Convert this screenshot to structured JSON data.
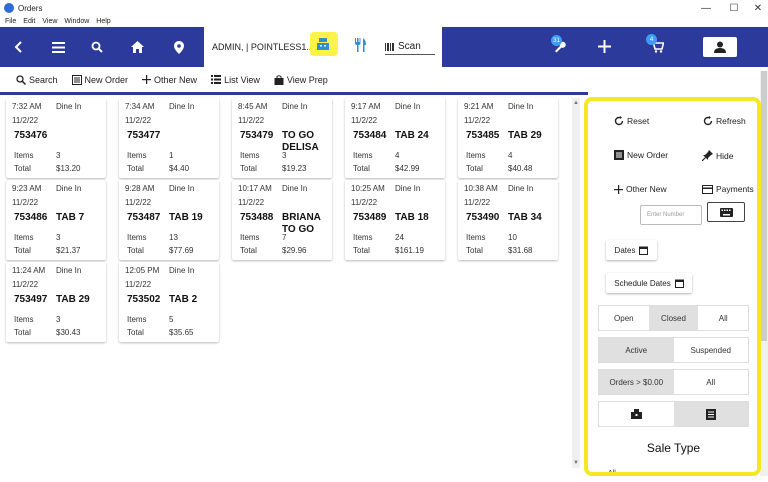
{
  "window": {
    "title": "Orders",
    "menu": [
      "File",
      "Edit",
      "View",
      "Window",
      "Help"
    ],
    "controls": [
      "—",
      "☐",
      "✕"
    ]
  },
  "header": {
    "user_label": "ADMIN, | POINTLESS1... |",
    "scan_label": "Scan",
    "badge_tools": "31",
    "badge_cart": "4",
    "accent": "#2b3a9b",
    "highlight": "#f5e721"
  },
  "toolbar": {
    "search": "Search",
    "new_order": "New Order",
    "other_new": "Other New",
    "list_view": "List View",
    "view_prep": "View Prep"
  },
  "orders": [
    {
      "time": "7:32 AM",
      "type": "Dine In",
      "date": "11/2/22",
      "number": "753476",
      "tab": "",
      "items_label": "Items",
      "items": "3",
      "total_label": "Total",
      "total": "$13.20"
    },
    {
      "time": "7:34 AM",
      "type": "Dine In",
      "date": "11/2/22",
      "number": "753477",
      "tab": "",
      "items_label": "Items",
      "items": "1",
      "total_label": "Total",
      "total": "$4.40"
    },
    {
      "time": "8:45 AM",
      "type": "Dine In",
      "date": "11/2/22",
      "number": "753479",
      "tab": "TO GO DELISA",
      "items_label": "Items",
      "items": "3",
      "total_label": "Total",
      "total": "$19.23"
    },
    {
      "time": "9:17 AM",
      "type": "Dine In",
      "date": "11/2/22",
      "number": "753484",
      "tab": "TAB 24",
      "items_label": "Items",
      "items": "4",
      "total_label": "Total",
      "total": "$42.99"
    },
    {
      "time": "9:21 AM",
      "type": "Dine In",
      "date": "11/2/22",
      "number": "753485",
      "tab": "TAB 29",
      "items_label": "Items",
      "items": "4",
      "total_label": "Total",
      "total": "$40.48"
    },
    {
      "time": "9:23 AM",
      "type": "Dine In",
      "date": "11/2/22",
      "number": "753486",
      "tab": "TAB 7",
      "items_label": "Items",
      "items": "3",
      "total_label": "Total",
      "total": "$21.37"
    },
    {
      "time": "9:28 AM",
      "type": "Dine In",
      "date": "11/2/22",
      "number": "753487",
      "tab": "TAB 19",
      "items_label": "Items",
      "items": "13",
      "total_label": "Total",
      "total": "$77.69"
    },
    {
      "time": "10:17 AM",
      "type": "Dine In",
      "date": "11/2/22",
      "number": "753488",
      "tab": "BRIANA TO GO",
      "items_label": "Items",
      "items": "7",
      "total_label": "Total",
      "total": "$29.96"
    },
    {
      "time": "10:25 AM",
      "type": "Dine In",
      "date": "11/2/22",
      "number": "753489",
      "tab": "TAB 18",
      "items_label": "Items",
      "items": "24",
      "total_label": "Total",
      "total": "$161.19"
    },
    {
      "time": "10:38 AM",
      "type": "Dine In",
      "date": "11/2/22",
      "number": "753490",
      "tab": "TAB 34",
      "items_label": "Items",
      "items": "10",
      "total_label": "Total",
      "total": "$31.68"
    },
    {
      "time": "11:24 AM",
      "type": "Dine In",
      "date": "11/2/22",
      "number": "753497",
      "tab": "TAB 29",
      "items_label": "Items",
      "items": "3",
      "total_label": "Total",
      "total": "$30.43"
    },
    {
      "time": "12:05 PM",
      "type": "Dine In",
      "date": "11/2/22",
      "number": "753502",
      "tab": "TAB 2",
      "items_label": "Items",
      "items": "5",
      "total_label": "Total",
      "total": "$35.65"
    }
  ],
  "panel": {
    "reset": "Reset",
    "refresh": "Refresh",
    "new_order": "New Order",
    "hide": "Hide",
    "other_new": "Other New",
    "payments": "Payments",
    "order_number_placeholder": "Enter Number",
    "dates": "Dates",
    "schedule_dates": "Schedule Dates",
    "status_filter": [
      "Open",
      "Closed",
      "All"
    ],
    "status_selected": "Closed",
    "active_filter": [
      "Active",
      "Suspended"
    ],
    "active_selected": "Active",
    "amount_filter": [
      "Orders > $0.00",
      "All"
    ],
    "amount_selected": "Orders > $0.00",
    "view_icons": [
      "register-icon",
      "receipt-icon"
    ],
    "view_selected": "receipt-icon",
    "sale_type_title": "Sale Type",
    "bottom_text": "All"
  }
}
